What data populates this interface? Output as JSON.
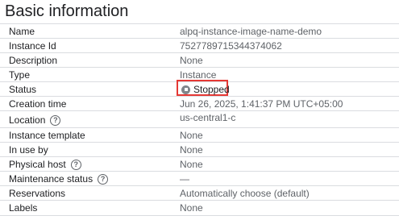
{
  "section": {
    "title": "Basic information"
  },
  "rows": [
    {
      "label": "Name",
      "value": "alpq-instance-image-name-demo"
    },
    {
      "label": "Instance Id",
      "value": "7527789715344374062"
    },
    {
      "label": "Description",
      "value": "None"
    },
    {
      "label": "Type",
      "value": "Instance"
    },
    {
      "label": "Status",
      "value": "Stopped",
      "status_icon": "stopped-icon"
    },
    {
      "label": "Creation time",
      "value": "Jun 26, 2025, 1:41:37 PM UTC+05:00"
    },
    {
      "label": "Location",
      "value": "us-central1-c",
      "help_icon": "help-icon"
    },
    {
      "label": "Instance template",
      "value": "None"
    },
    {
      "label": "In use by",
      "value": "None"
    },
    {
      "label": "Physical host",
      "value": "None",
      "help_icon": "help-icon"
    },
    {
      "label": "Maintenance status",
      "value": "—",
      "help_icon": "help-icon"
    },
    {
      "label": "Reservations",
      "value": "Automatically choose (default)"
    },
    {
      "label": "Labels",
      "value": "None"
    }
  ],
  "colors": {
    "highlight_border": "#e53935",
    "divider": "#dadce0",
    "label_text": "#202124",
    "value_text": "#5f6368"
  }
}
